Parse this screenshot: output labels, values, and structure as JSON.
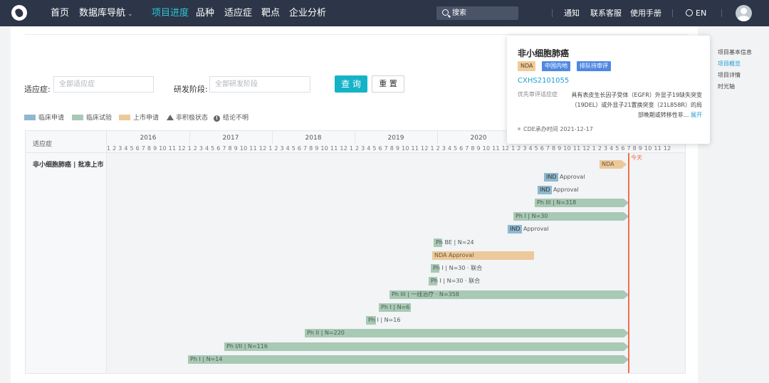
{
  "nav": {
    "items": [
      "首页",
      "数据库导航",
      "项目进度",
      "品种",
      "适应症",
      "靶点",
      "企业分析"
    ],
    "chevron": "⌄",
    "search_placeholder": "搜索",
    "links": [
      "通知",
      "联系客服",
      "使用手册"
    ],
    "lang": "EN"
  },
  "filters": {
    "indication_label": "适应症:",
    "indication_placeholder": "全部适应症",
    "phase_label": "研发阶段:",
    "phase_placeholder": "全部研发阶段",
    "query": "查 询",
    "reset": "重 置"
  },
  "legend": {
    "clinical_apply": "临床申请",
    "clinical_trial": "临床试验",
    "market_apply": "上市申请",
    "inactive": "非积极状态",
    "inconclusive": "结论不明"
  },
  "colors": {
    "clinical_apply": "#8fb8ce",
    "clinical_trial": "#a8c9b4",
    "market_apply": "#ecc99b",
    "today": "#ef6f4a",
    "accent": "#15b3c8"
  },
  "gantt": {
    "col_header": "适应症",
    "indication": "非小细胞肺癌 | 批准上市",
    "years": [
      "2016",
      "2017",
      "2018",
      "2019",
      "2020"
    ],
    "months_line": "1 2 3 4 5 6 7 8 9 10 11 12 1 2 3 4 5 6 7 8 9 10 11 12 1 2 3 4 5 6 7 8 9 10 11 12 1 2 3 4 5 6 7 8 9 10 11 12 1 2 3 4 5 6 7 8 9 10 11 12 1 2 3 4 5 6 7 8 9 10 11 12 1 2 3 4 5 6 7 8 9 10 11 12",
    "today_label": "今天",
    "bars": [
      {
        "label": "NDA"
      },
      {
        "label": "IND",
        "extra": "Approval"
      },
      {
        "label": "IND",
        "extra": "Approval"
      },
      {
        "label": "Ph III | N=318"
      },
      {
        "label": "Ph I | N=30"
      },
      {
        "label": "IND",
        "extra": "Approval"
      },
      {
        "label": "Ph BE | N=24"
      },
      {
        "label": "NDA Approval"
      },
      {
        "label": "Ph I | N=30 · 联合"
      },
      {
        "label": "Ph I | N=30 · 联合"
      },
      {
        "label": "Ph III | 一线治疗 · N=358"
      },
      {
        "label": "Ph I | N=6"
      },
      {
        "label": "Ph I | N=16"
      },
      {
        "label": "Ph II | N=220"
      },
      {
        "label": "Ph I/II | N=116"
      },
      {
        "label": "Ph I | N=14"
      }
    ]
  },
  "popup": {
    "title": "非小细胞肺癌",
    "tags": [
      "NDA",
      "中国内地",
      "排队待审评"
    ],
    "code": "CXHS2101055",
    "desc_label": "优先审评适应症",
    "desc": "具有表皮生长因子受体（EGFR）外显子19缺失突变（19DEL）或外显子21置换突变（21L858R）的局部晚期或转移性非...",
    "more": "展开",
    "date": "CDE承办时间 2021-12-17"
  },
  "anchors": [
    "项目基本信息",
    "项目概览",
    "项目详情",
    "时光轴"
  ]
}
